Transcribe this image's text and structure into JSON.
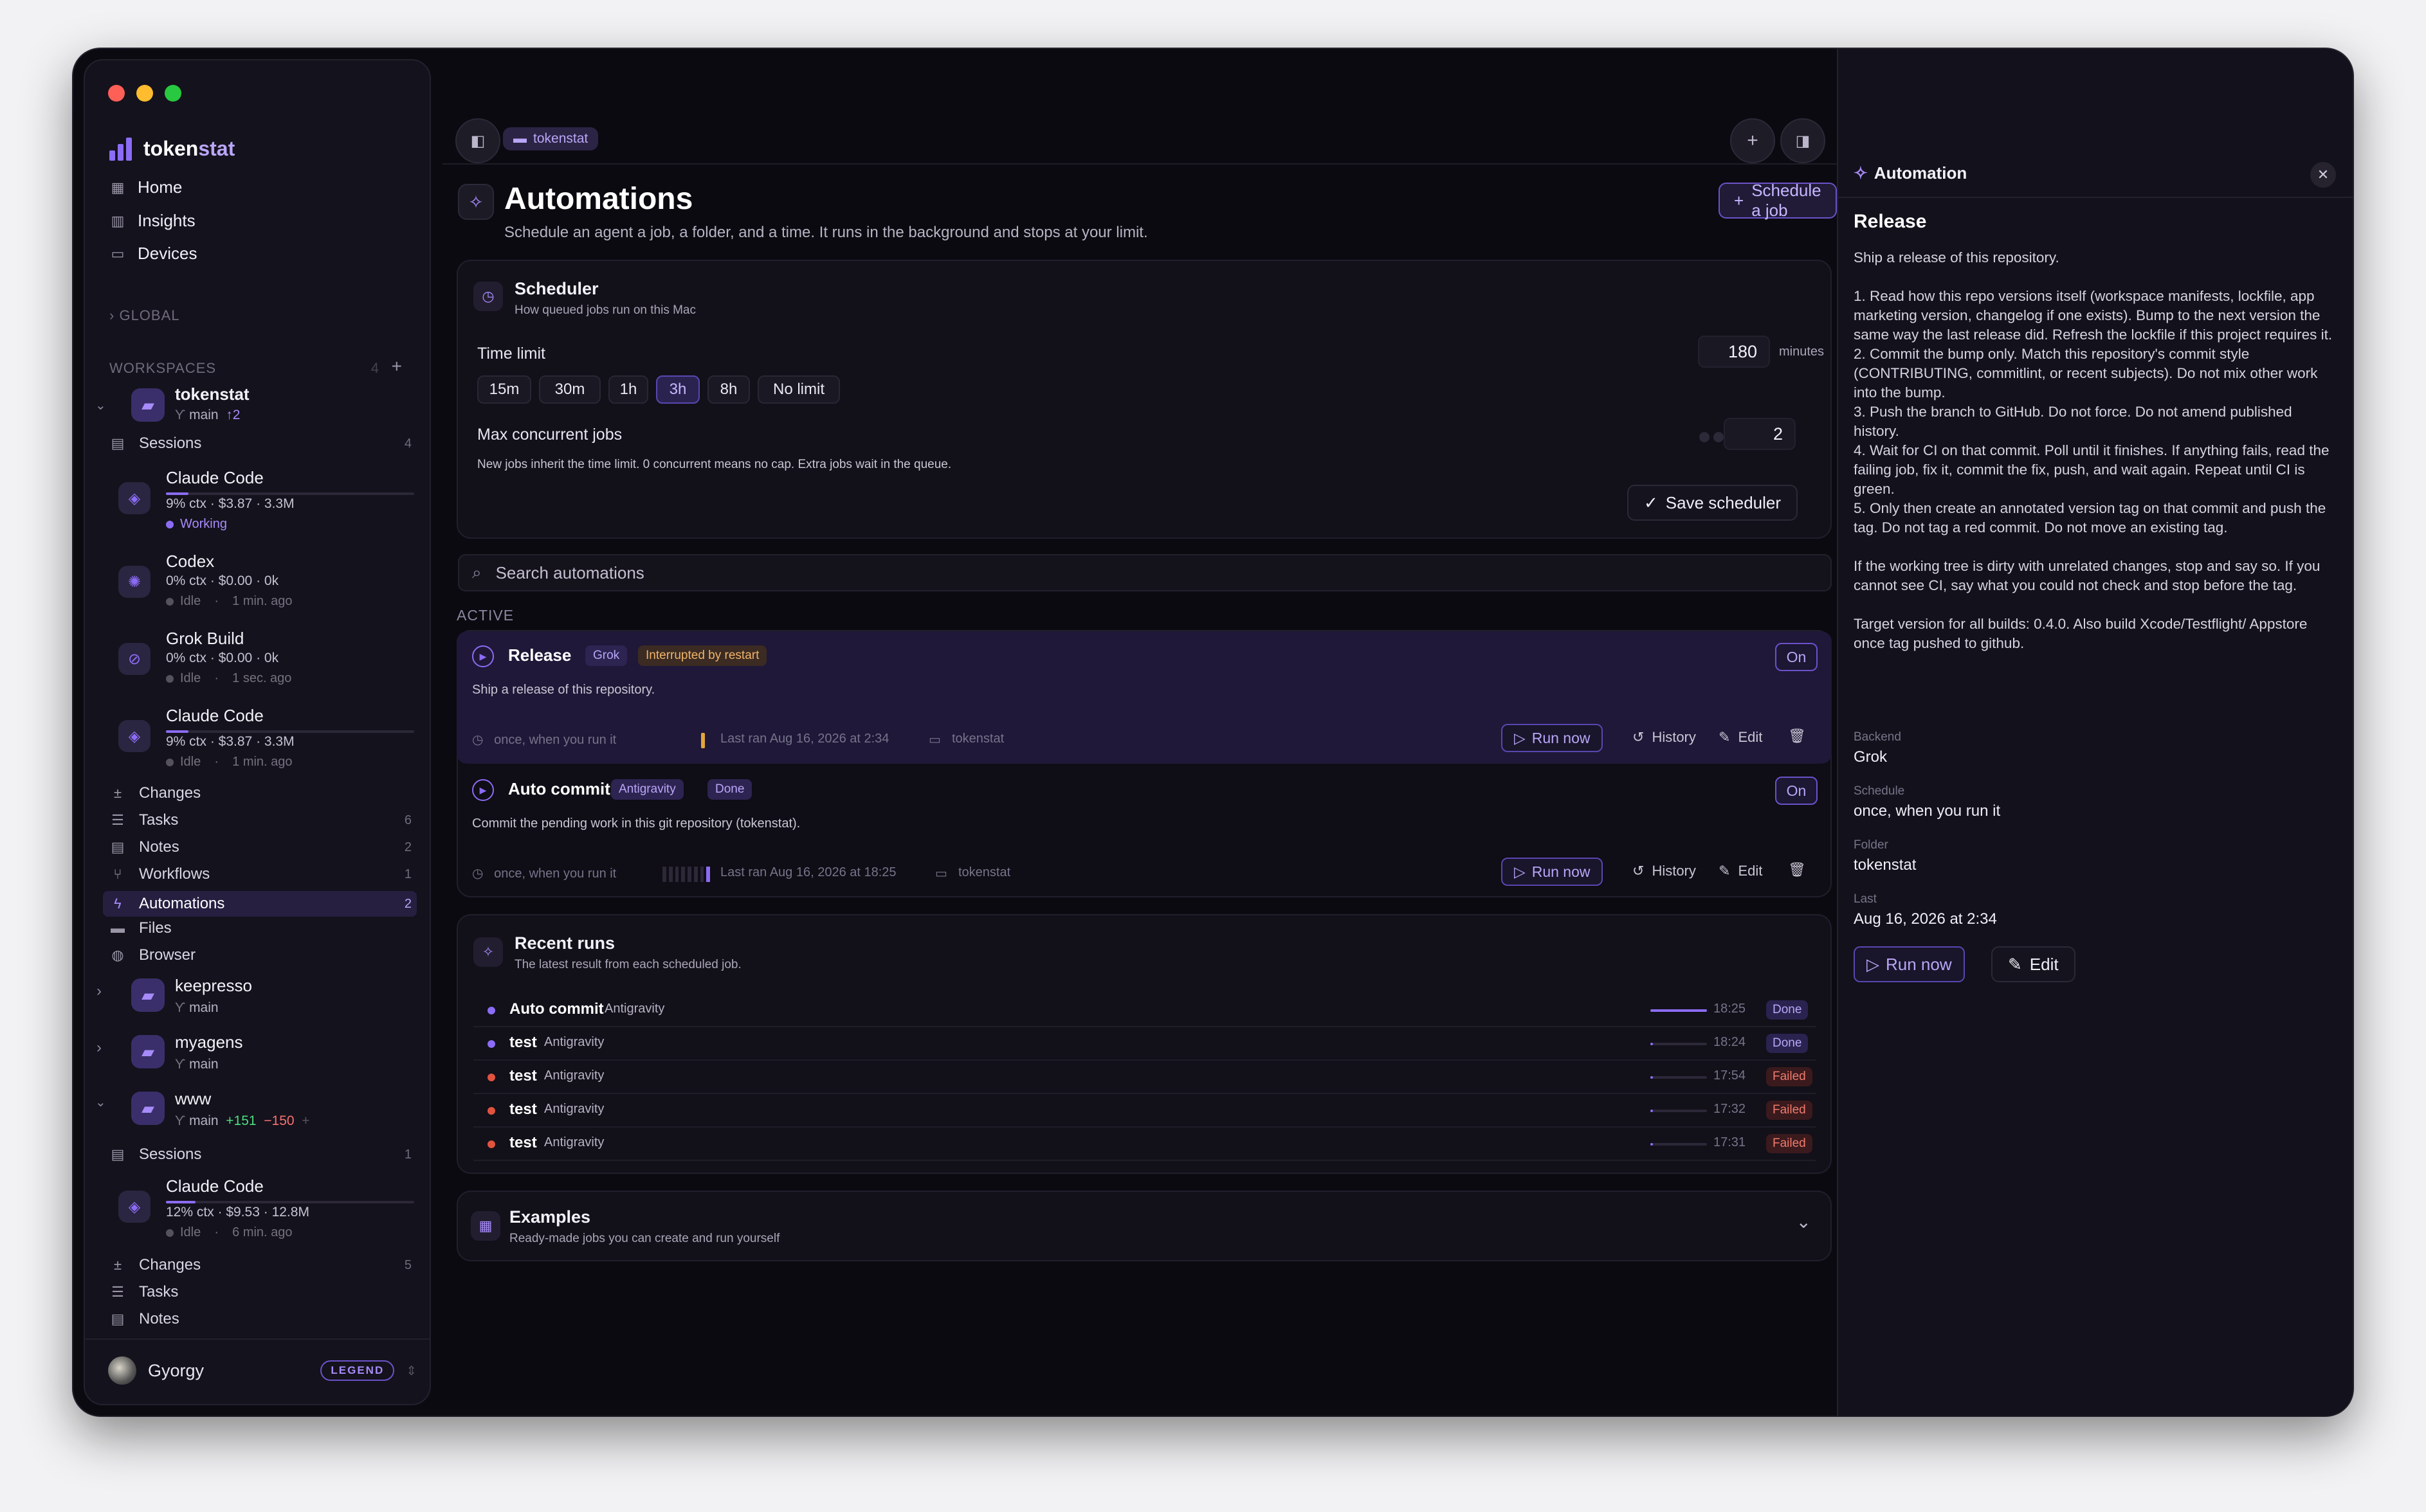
{
  "app": {
    "name_a": "token",
    "name_b": "stat"
  },
  "nav": [
    {
      "label": "Home",
      "icon": "grid-icon"
    },
    {
      "label": "Insights",
      "icon": "bar-chart-icon"
    },
    {
      "label": "Devices",
      "icon": "monitor-icon"
    }
  ],
  "global_label": "GLOBAL",
  "workspaces_label": "WORKSPACES",
  "workspaces_count": "4",
  "ws1": {
    "name": "tokenstat",
    "branch": "main",
    "ahead": "↑2",
    "sessions_label": "Sessions",
    "sessions_count": "4",
    "agents": [
      {
        "name": "Claude Code",
        "meta": "9% ctx · $3.87 · 3.3M",
        "status": "Working",
        "progress": 0.09
      },
      {
        "name": "Codex",
        "meta": "0% ctx · $0.00 · 0k",
        "status": "Idle",
        "ago": "1 min. ago",
        "progress": 0
      },
      {
        "name": "Grok Build",
        "meta": "0% ctx · $0.00 · 0k",
        "status": "Idle",
        "ago": "1 sec. ago",
        "progress": 0
      },
      {
        "name": "Claude Code",
        "meta": "9% ctx · $3.87 · 3.3M",
        "status": "Idle",
        "ago": "1 min. ago",
        "progress": 0.09
      }
    ],
    "items": [
      {
        "label": "Changes",
        "count": ""
      },
      {
        "label": "Tasks",
        "count": "6"
      },
      {
        "label": "Notes",
        "count": "2"
      },
      {
        "label": "Workflows",
        "count": "1"
      },
      {
        "label": "Automations",
        "count": "2"
      },
      {
        "label": "Files",
        "count": ""
      },
      {
        "label": "Browser",
        "count": ""
      }
    ]
  },
  "ws2": {
    "name": "keepresso",
    "branch": "main"
  },
  "ws3": {
    "name": "myagens",
    "branch": "main"
  },
  "ws4": {
    "name": "www",
    "branch": "main",
    "added": "+151",
    "removed": "−150",
    "plus": "+",
    "sessions_label": "Sessions",
    "sessions_count": "1",
    "agent": {
      "name": "Claude Code",
      "meta": "12% ctx · $9.53 · 12.8M",
      "status": "Idle",
      "ago": "6 min. ago",
      "progress": 0.12
    },
    "items": [
      {
        "label": "Changes",
        "count": "5"
      },
      {
        "label": "Tasks",
        "count": ""
      },
      {
        "label": "Notes",
        "count": ""
      }
    ]
  },
  "user": {
    "name": "Gyorgy",
    "badge": "LEGEND"
  },
  "header": {
    "crumb": "tokenstat"
  },
  "page": {
    "title": "Automations",
    "subtitle": "Schedule an agent a job, a folder, and a time. It runs in the background and stops at your limit.",
    "schedule_button": "Schedule a job"
  },
  "scheduler": {
    "title": "Scheduler",
    "subtitle": "How queued jobs run on this Mac",
    "time_limit_label": "Time limit",
    "time_limit_value": "180",
    "time_limit_unit": "minutes",
    "options": [
      "15m",
      "30m",
      "1h",
      "3h",
      "8h",
      "No limit"
    ],
    "selected": "3h",
    "concurrent_label": "Max concurrent jobs",
    "concurrent_value": "2",
    "note": "New jobs inherit the time limit. 0 concurrent means no cap. Extra jobs wait in the queue.",
    "save_button": "Save scheduler"
  },
  "search": {
    "placeholder": "Search automations"
  },
  "active_label": "ACTIVE",
  "jobs": [
    {
      "name": "Release",
      "backend": "Grok",
      "status": "Interrupted by restart",
      "desc": "Ship a release of this repository.",
      "schedule": "once, when you run it",
      "last": "Last ran Aug 16, 2026 at 2:34",
      "folder": "tokenstat",
      "toggle": "On",
      "run": "Run now",
      "history": "History",
      "edit": "Edit"
    },
    {
      "name": "Auto commit",
      "backend": "Antigravity",
      "status": "Done",
      "desc": "Commit the pending work in this git repository (tokenstat).",
      "schedule": "once, when you run it",
      "last": "Last ran Aug 16, 2026 at 18:25",
      "folder": "tokenstat",
      "toggle": "On",
      "run": "Run now",
      "history": "History",
      "edit": "Edit"
    }
  ],
  "recent": {
    "title": "Recent runs",
    "subtitle": "The latest result from each scheduled job.",
    "runs": [
      {
        "name": "Auto commit",
        "agent": "Antigravity",
        "time": "18:25",
        "status": "Done",
        "progress": 1.0
      },
      {
        "name": "test",
        "agent": "Antigravity",
        "time": "18:24",
        "status": "Done",
        "progress": 0.05
      },
      {
        "name": "test",
        "agent": "Antigravity",
        "time": "17:54",
        "status": "Failed",
        "progress": 0.05
      },
      {
        "name": "test",
        "agent": "Antigravity",
        "time": "17:32",
        "status": "Failed",
        "progress": 0.05
      },
      {
        "name": "test",
        "agent": "Antigravity",
        "time": "17:31",
        "status": "Failed",
        "progress": 0.05
      }
    ]
  },
  "examples": {
    "title": "Examples",
    "subtitle": "Ready-made jobs you can create and run yourself"
  },
  "panel": {
    "header": "Automation",
    "title": "Release",
    "text": "Ship a release of this repository.\n\n1. Read how this repo versions itself (workspace manifests, lockfile, app marketing version, changelog if one exists). Bump to the next version the same way the last release did. Refresh the lockfile if this project requires it.\n2. Commit the bump only. Match this repository's commit style (CONTRIBUTING, commitlint, or recent subjects). Do not mix other work into the bump.\n3. Push the branch to GitHub. Do not force. Do not amend published history.\n4. Wait for CI on that commit. Poll until it finishes. If anything fails, read the failing job, fix it, commit the fix, push, and wait again. Repeat until CI is green.\n5. Only then create an annotated version tag on that commit and push the tag. Do not tag a red commit. Do not move an existing tag.\n\nIf the working tree is dirty with unrelated changes, stop and say so. If you cannot see CI, say what you could not check and stop before the tag.\n\nTarget version for all builds: 0.4.0. Also build Xcode/Testflight/ Appstore once tag pushed to github.",
    "backend_label": "Backend",
    "backend": "Grok",
    "schedule_label": "Schedule",
    "schedule": "once, when you run it",
    "folder_label": "Folder",
    "folder": "tokenstat",
    "last_label": "Last",
    "last": "Aug 16, 2026 at 2:34",
    "run": "Run now",
    "edit": "Edit"
  },
  "colors": {
    "accent": "#8b6cf5",
    "working": "#8b6cf5",
    "failed": "#e0533f",
    "done_bg": "#2a2350"
  }
}
